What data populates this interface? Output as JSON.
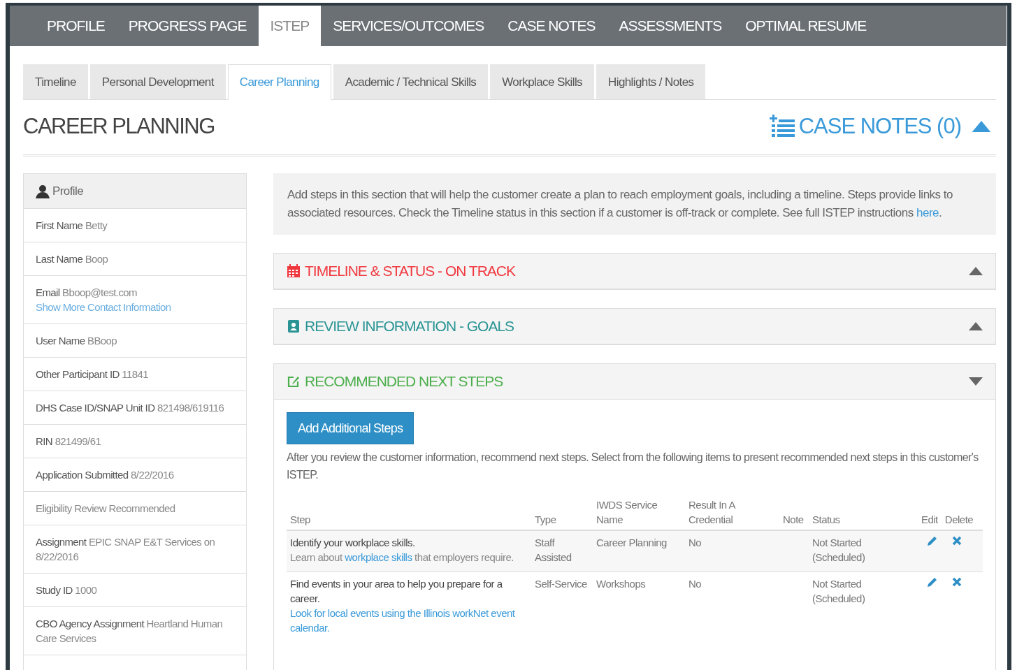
{
  "top_nav": [
    {
      "label": "PROFILE",
      "selected": false
    },
    {
      "label": "PROGRESS PAGE",
      "selected": false
    },
    {
      "label": "ISTEP",
      "selected": true
    },
    {
      "label": "SERVICES/OUTCOMES",
      "selected": false
    },
    {
      "label": "CASE NOTES",
      "selected": false
    },
    {
      "label": "ASSESSMENTS",
      "selected": false
    },
    {
      "label": "OPTIMAL RESUME",
      "selected": false
    }
  ],
  "sub_tabs": [
    {
      "label": "Timeline",
      "selected": false
    },
    {
      "label": "Personal Development",
      "selected": false
    },
    {
      "label": "Career Planning",
      "selected": true
    },
    {
      "label": "Academic / Technical Skills",
      "selected": false
    },
    {
      "label": "Workplace Skills",
      "selected": false
    },
    {
      "label": "Highlights / Notes",
      "selected": false
    }
  ],
  "page_title": "CAREER PLANNING",
  "case_notes": {
    "label": "CASE NOTES (0)",
    "expanded": false
  },
  "profile": {
    "title": "Profile",
    "items": [
      {
        "label": "First Name",
        "value": "Betty"
      },
      {
        "label": "Last Name",
        "value": "Boop"
      },
      {
        "label": "Email",
        "value": "Bboop@test.com",
        "link": "Show More Contact Information"
      },
      {
        "label": "User Name",
        "value": "BBoop"
      },
      {
        "label": "Other Participant ID",
        "value": "11841"
      },
      {
        "label": "DHS Case ID/SNAP Unit ID",
        "value": "821498/619116"
      },
      {
        "label": "RIN",
        "value": "821499/61"
      },
      {
        "label": "Application Submitted",
        "value": "8/22/2016"
      },
      {
        "value": "Eligibility Review Recommended"
      },
      {
        "label": "Assignment",
        "value": "EPIC SNAP E&T Services on 8/22/2016"
      },
      {
        "label": "Study ID",
        "value": "1000"
      },
      {
        "label": "CBO Agency Assignment",
        "value": "Heartland Human Care Services"
      }
    ]
  },
  "info": {
    "text": "Add steps in this section that will help the customer create a plan to reach employment goals, including a timeline. Steps provide links to associated resources. Check the Timeline status in this section if a customer is off-track or complete. See full ISTEP instructions ",
    "link": "here",
    "end": "."
  },
  "sections": [
    {
      "kind": "calendar",
      "title": "TIMELINE & STATUS - ON TRACK",
      "color": "#f0393f",
      "expanded": false
    },
    {
      "kind": "contact",
      "title": "REVIEW INFORMATION - GOALS",
      "color": "#2a9494",
      "expanded": false
    },
    {
      "kind": "edit",
      "title": "RECOMMENDED NEXT STEPS",
      "color": "#4cae4c",
      "expanded": true
    }
  ],
  "next_steps": {
    "button": "Add Additional Steps",
    "intro": "After you review the customer information, recommend next steps. Select from the following items to present recommended next steps in this customer's ISTEP.",
    "columns": [
      "Step",
      "Type",
      "IWDS Service Name",
      "Result In A Credential",
      "Note",
      "Status",
      "Edit",
      "Delete"
    ],
    "rows": [
      {
        "step": "Identify your workplace skills.",
        "desc": [
          {
            "text": "Learn about ",
            "link": false
          },
          {
            "text": "workplace skills",
            "link": true
          },
          {
            "text": " that employers require.",
            "link": false
          }
        ],
        "type": "Staff Assisted",
        "service": "Career Planning",
        "credential": "No",
        "status": "Not Started (Scheduled)"
      },
      {
        "step": "Find events in your area to help you prepare for a career.",
        "desc": [
          {
            "text": "Look for local events using the Illinois workNet event calendar.",
            "link": true
          }
        ],
        "type": "Self-Service",
        "service": "Workshops",
        "credential": "No",
        "status": "Not Started (Scheduled)"
      }
    ]
  }
}
